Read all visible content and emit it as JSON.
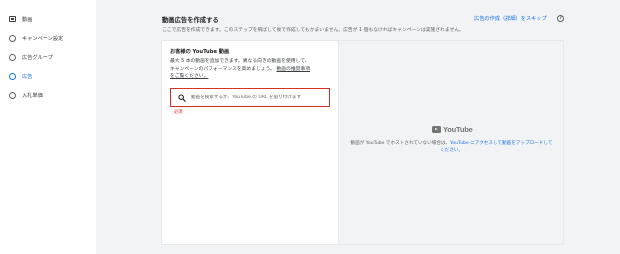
{
  "sidebar": {
    "items": [
      {
        "label": "動画",
        "icon": "video-icon"
      },
      {
        "label": "キャンペーン設定",
        "icon": "circle-icon"
      },
      {
        "label": "広告グループ",
        "icon": "circle-icon"
      },
      {
        "label": "広告",
        "icon": "circle-icon",
        "active": true
      },
      {
        "label": "入札単価",
        "icon": "circle-icon"
      }
    ]
  },
  "header": {
    "title": "動画広告を作成する",
    "subtitle": "ここで広告を作成できます。このステップを飛ばして後で作成してもかまいません。広告が 1 個もなければキャンペーンは実施されません。",
    "skip_link": "広告の作成（詳細）をスキップ",
    "help_icon": "?"
  },
  "video_panel": {
    "heading": "お客様の YouTube 動画",
    "description_line1": "最大 5 本の動画を追加できます。異なる向きの動画を使用して、",
    "description_line2_prefix": "キャンペーンのパフォーマンスを高めましょう。",
    "description_link_part1": "動画の推奨事項",
    "description_link_part2": "をご覧ください。",
    "search_placeholder": "動画を検索するか、YouTube の URL を貼り付けます",
    "required_label": "必須"
  },
  "preview_panel": {
    "logo_text": "YouTube",
    "upload_prefix": "動画が YouTube でホストされていない場合は、",
    "upload_link": "YouTube にアクセスして動画をアップロードして",
    "upload_link_line2": "ください。"
  },
  "colors": {
    "accent": "#1a73e8",
    "error": "#d93025",
    "background": "#f1f3f4"
  }
}
